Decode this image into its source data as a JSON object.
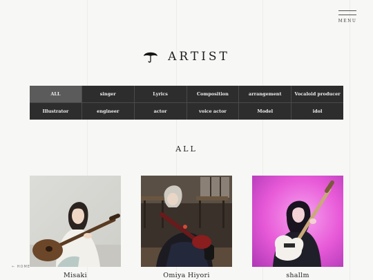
{
  "menu": {
    "label": "MENU",
    "icon": "hamburger-icon"
  },
  "title": {
    "text": "ARTIST",
    "icon": "umbrella-icon"
  },
  "filters": [
    {
      "label": "ALL",
      "active": true
    },
    {
      "label": "singer",
      "active": false
    },
    {
      "label": "Lyrics",
      "active": false
    },
    {
      "label": "Composition",
      "active": false
    },
    {
      "label": "arrangement",
      "active": false
    },
    {
      "label": "Vocaloid producer",
      "active": false
    },
    {
      "label": "Illustrator",
      "active": false
    },
    {
      "label": "engineer",
      "active": false
    },
    {
      "label": "actor",
      "active": false
    },
    {
      "label": "voice actor",
      "active": false
    },
    {
      "label": "Model",
      "active": false
    },
    {
      "label": "idol",
      "active": false
    }
  ],
  "section": {
    "heading": "ALL"
  },
  "artists": [
    {
      "name": "Misaki"
    },
    {
      "name": "Omiya Hiyori"
    },
    {
      "name": "shallm"
    }
  ],
  "nav": {
    "home": "← HOME"
  },
  "colors": {
    "background": "#f7f7f5",
    "filter_bg": "#2d2d2d",
    "filter_active": "#5b5b5b",
    "accent_pink": "#e85ad8"
  }
}
